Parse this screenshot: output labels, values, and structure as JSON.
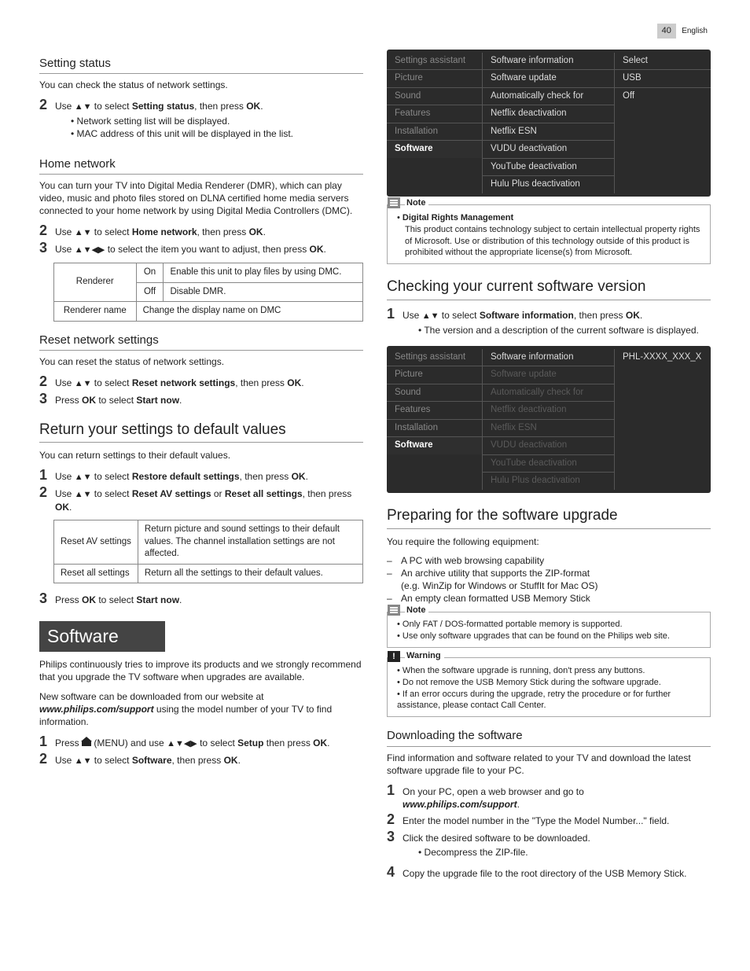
{
  "page": {
    "number": "40",
    "lang": "English"
  },
  "left": {
    "setting_status": {
      "heading": "Setting status",
      "intro": "You can check the status of network settings.",
      "step2_pre": "Use ",
      "step2_mid": " to select ",
      "step2_target": "Setting status",
      "step2_post": ", then press ",
      "ok": "OK",
      "bullets": [
        "Network setting list will be displayed.",
        "MAC address of this unit will be displayed in the list."
      ]
    },
    "home_network": {
      "heading": "Home network",
      "intro": "You can turn your TV into Digital Media Renderer (DMR), which can play video, music and photo files stored on DLNA certified home media servers connected to your home network by using Digital Media Controllers (DMC).",
      "step2": {
        "pre": "Use ",
        "mid": " to select ",
        "target": "Home network",
        "post": ", then press ",
        "ok": "OK",
        "dot": "."
      },
      "step3": {
        "pre": "Use ",
        "mid": " to select the item you want to adjust, then press ",
        "ok": "OK",
        "dot": "."
      },
      "table": {
        "renderer": "Renderer",
        "on": "On",
        "on_desc": "Enable this unit to play files by using DMC.",
        "off": "Off",
        "off_desc": "Disable DMR.",
        "renderer_name": "Renderer name",
        "renderer_name_desc": "Change the display name on DMC"
      }
    },
    "reset_network": {
      "heading": "Reset network settings",
      "intro": "You can reset the status of network settings.",
      "step2": {
        "pre": "Use ",
        "mid": " to select ",
        "target": "Reset network settings",
        "post": ", then press ",
        "ok": "OK",
        "dot": "."
      },
      "step3": {
        "pre": "Press ",
        "ok": "OK",
        "mid": " to select ",
        "target": "Start now",
        "dot": "."
      }
    },
    "return_defaults": {
      "heading": "Return your settings to default values",
      "intro": "You can return settings to their default values.",
      "step1": {
        "pre": "Use ",
        "mid": " to select ",
        "target": "Restore default settings",
        "post": ", then press ",
        "ok": "OK",
        "dot": "."
      },
      "step2": {
        "pre": "Use ",
        "mid": " to select ",
        "t1": "Reset AV settings",
        "or": " or ",
        "t2": "Reset all settings",
        "post": ", then press ",
        "ok": "OK",
        "dot": "."
      },
      "table": {
        "rav": "Reset AV settings",
        "rav_desc": "Return picture and sound settings to their default values. The channel installation settings are not affected.",
        "rall": "Reset all settings",
        "rall_desc": "Return all the settings to their default values."
      },
      "step3": {
        "pre": "Press ",
        "ok": "OK",
        "mid": " to select ",
        "target": "Start now",
        "dot": "."
      }
    },
    "software": {
      "heading": "Software",
      "p1": "Philips continuously tries to improve its products and we strongly recommend that you upgrade the TV software when upgrades are available.",
      "p2a": "New software can be downloaded from our website at ",
      "url": "www.philips.com/support",
      "p2b": " using the model number of your TV to find information.",
      "step1": {
        "pre": "Press ",
        "menu": "(MENU)",
        "and": " and use ",
        "mid": " to select ",
        "target": "Setup",
        "post": " then press ",
        "ok": "OK",
        "dot": "."
      },
      "step2": {
        "pre": "Use ",
        "mid": " to select ",
        "target": "Software",
        "post": ", then press ",
        "ok": "OK",
        "dot": "."
      }
    }
  },
  "right": {
    "menu1": {
      "left": [
        "Settings assistant",
        "Picture",
        "Sound",
        "Features",
        "Installation",
        "Software"
      ],
      "left_sel": 5,
      "mid": [
        "Software information",
        "Software update",
        "Automatically check for",
        "Netflix deactivation",
        "Netflix ESN",
        "VUDU deactivation",
        "YouTube deactivation",
        "Hulu Plus deactivation"
      ],
      "right": [
        "Select",
        "USB",
        "Off"
      ]
    },
    "note1": {
      "label": "Note",
      "title": "Digital Rights Management",
      "body": "This product contains technology subject to certain intellectual property rights of Microsoft. Use or distribution of this technology outside of this product is prohibited without the appropriate license(s) from Microsoft."
    },
    "check_version": {
      "heading": "Checking your current software version",
      "step1": {
        "pre": "Use ",
        "mid": " to select ",
        "target": "Software information",
        "post": ", then press ",
        "ok": "OK",
        "dot": "."
      },
      "bullet": "The version and a description of the current software is displayed."
    },
    "menu2": {
      "left": [
        "Settings assistant",
        "Picture",
        "Sound",
        "Features",
        "Installation",
        "Software"
      ],
      "left_sel": 5,
      "mid_sel": "Software information",
      "mid_dim": [
        "Software update",
        "Automatically check for",
        "Netflix deactivation",
        "Netflix ESN",
        "VUDU deactivation",
        "YouTube deactivation",
        "Hulu Plus deactivation"
      ],
      "right": "PHL-XXXX_XXX_X"
    },
    "preparing": {
      "heading": "Preparing for the software upgrade",
      "intro": "You require the following equipment:",
      "items": [
        "A PC with web browsing capability",
        "An archive utility that supports the ZIP-format",
        "(e.g. WinZip for Windows or StuffIt for Mac OS)",
        "An empty clean formatted USB Memory Stick"
      ]
    },
    "note2": {
      "label": "Note",
      "lines": [
        "Only FAT / DOS-formatted portable memory is supported.",
        "Use only software upgrades that can be found on the Philips web site."
      ]
    },
    "warn": {
      "label": "Warning",
      "lines": [
        "When the software upgrade is running, don't press any buttons.",
        "Do not remove the USB Memory Stick during the software upgrade.",
        "If an error occurs during the upgrade, retry the procedure or for further assistance, please contact Call Center."
      ]
    },
    "downloading": {
      "heading": "Downloading the software",
      "intro": "Find information and software related to your TV and download the latest software upgrade file to your PC.",
      "step1a": "On your PC, open a web browser and go to",
      "step1b": "www.philips.com/support",
      "step2": "Enter the model number in the \"Type the Model Number...\" field.",
      "step3": "Click the desired software to be downloaded.",
      "step3b": "Decompress the ZIP-file.",
      "step4": "Copy the upgrade file to the root directory of the USB Memory Stick."
    }
  },
  "glyph": {
    "ud": "▲▼",
    "udlr": "▲▼◀▶",
    "dot": "."
  }
}
